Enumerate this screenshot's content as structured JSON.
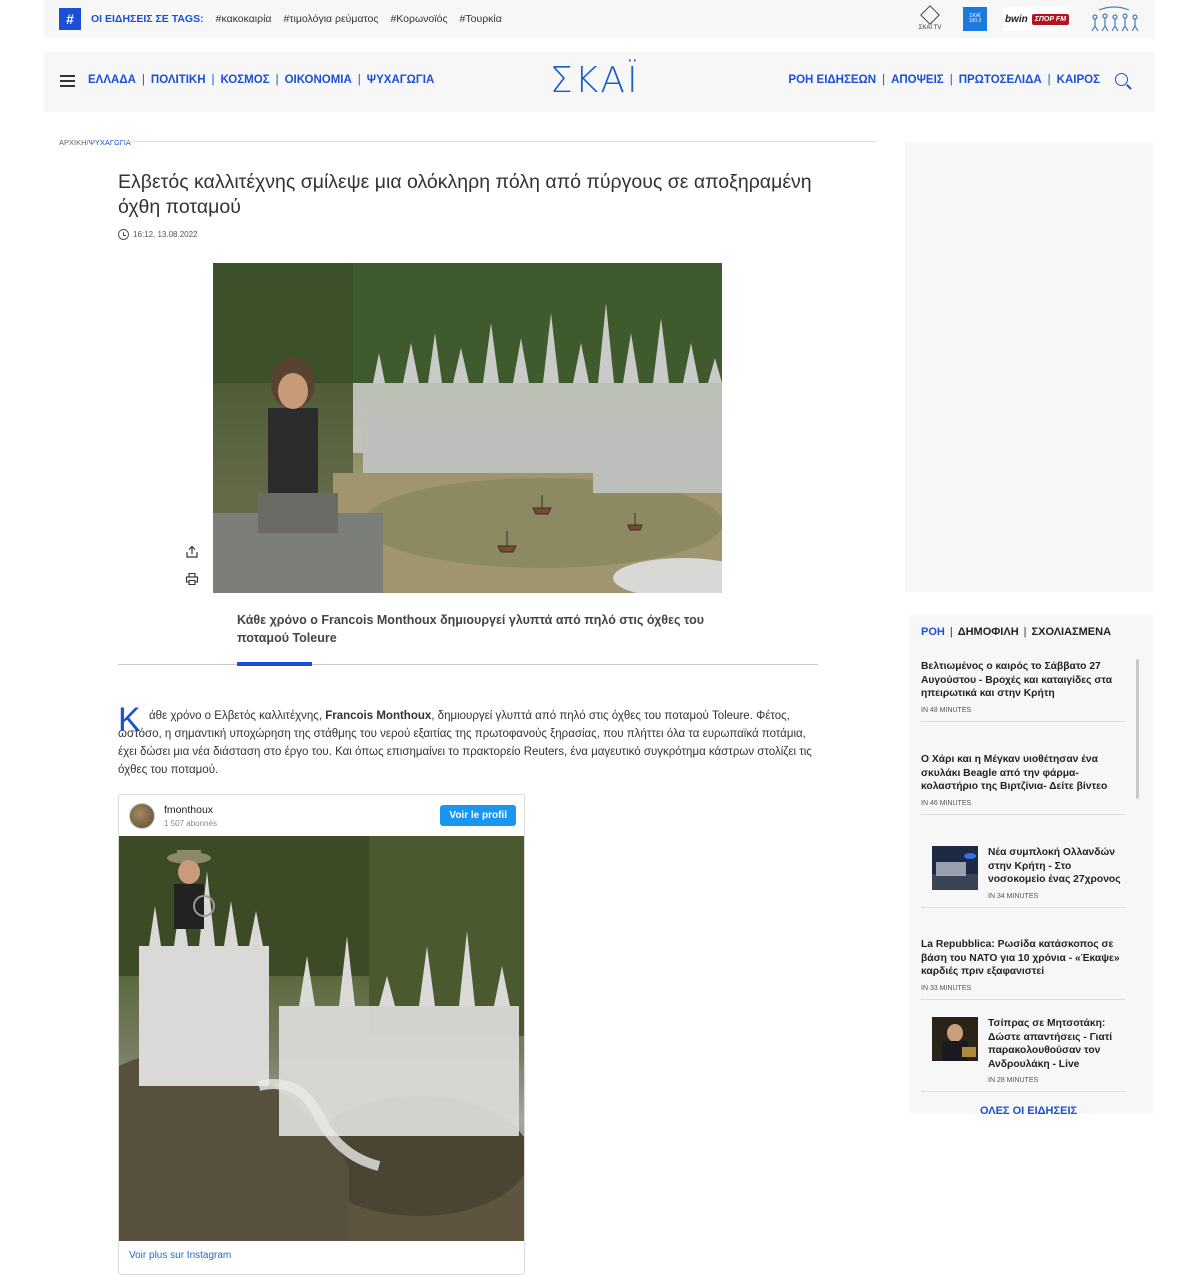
{
  "tagbar": {
    "hash": "#",
    "title": "ΟΙ ΕΙΔΗΣΕΙΣ ΣΕ TAGS:",
    "tags": [
      "#κακοκαιρία",
      "#τιμολόγια ρεύματος",
      "#Κορωνοϊός",
      "#Τουρκία"
    ],
    "icons": {
      "tv_label": "ΣΚΑΪ TV",
      "radio_label": "ΣΚΑΪ 100.3",
      "bwin_label": "bwin",
      "sport_label": "ΣΠΟΡ FM"
    }
  },
  "nav": {
    "left": [
      "ΕΛΛΑΔΑ",
      "ΠΟΛΙΤΙΚΗ",
      "ΚΟΣΜΟΣ",
      "ΟΙΚΟΝΟΜΙΑ",
      "ΨΥΧΑΓΩΓΙΑ"
    ],
    "right": [
      "ΡΟΗ ΕΙΔΗΣΕΩΝ",
      "ΑΠΟΨΕΙΣ",
      "ΠΡΩΤΟΣΕΛΙΔΑ",
      "ΚΑΙΡΟΣ"
    ],
    "logo": "ΣΚΑΪ",
    "sep": "|"
  },
  "breadcrumb": {
    "home": "ΑΡΧΙΚΗ",
    "sep": "/",
    "current": "ΨΥΧΑΓΩΓΙΑ"
  },
  "article": {
    "title": "Ελβετός καλλιτέχνης σμίλεψε μια ολόκληρη πόλη από πύργους σε αποξηραμένη όχθη ποταμού",
    "datetime": "16:12, 13.08.2022",
    "caption": "Κάθε χρόνο ο Francois Monthoux δημιουργεί γλυπτά από πηλό στις όχθες του ποταμού Toleure",
    "dropcap": "Κ",
    "body_before": "άθε χρόνο ο Ελβετός καλλιτέχνης, ",
    "body_bold": "Francois Monthoux",
    "body_after": ", δημιουργεί γλυπτά από πηλό στις όχθες του ποταμού Toleure. Φέτος, ωστόσο, η σημαντική υποχώρηση της στάθμης του νερού εξαιτίας της πρωτοφανούς ξηρασίας, που  πλήττει όλα τα ευρωπαϊκά ποτάμια, έχει δώσει μια νέα διάσταση στο έργο του. Και όπως επισημαίνει το πρακτορείο Reuters, ένα μαγευτικό  συγκρότημα κάστρων στολίζει τις όχθες του ποταμού."
  },
  "instagram": {
    "username": "fmonthoux",
    "followers": "1 507 abonnés",
    "button": "Voir le profil",
    "more": "Voir plus sur Instagram"
  },
  "sidebar": {
    "tabs": [
      "ΡΟΗ",
      "ΔΗΜΟΦΙΛΗ",
      "ΣΧΟΛΙΑΣΜΕΝΑ"
    ],
    "items": [
      {
        "title": "Βελτιωμένος ο καιρός το Σάββατο 27 Αυγούστου - Βροχές και καταιγίδες στα ηπειρωτικά και στην Κρήτη",
        "time": "IN 48 MINUTES"
      },
      {
        "title": "Ο Χάρι και η Μέγκαν υιοθέτησαν ένα σκυλάκι Beagle από την φάρμα-κολαστήριο της Βιρτζίνια- Δείτε βίντεο",
        "time": "IN 46 MINUTES"
      },
      {
        "title": "Νέα συμπλοκή Ολλανδών στην Κρήτη - Στο νοσοκομείο ένας 27χρονος",
        "time": "IN 34 MINUTES"
      },
      {
        "title": "La Repubblica: Ρωσίδα κατάσκοπος σε βάση του ΝΑΤΟ για 10 χρόνια - «Έκαψε» καρδιές πριν εξαφανιστεί",
        "time": "IN 33 MINUTES"
      },
      {
        "title": "Τσίπρας σε Μητσοτάκη: Δώστε απαντήσεις - Γιατί παρακολουθούσαν τον Ανδρουλάκη - Live",
        "time": "IN 28 MINUTES"
      }
    ],
    "all_news": "ΟΛΕΣ ΟΙ ΕΙΔΗΣΕΙΣ"
  },
  "colors": {
    "accent": "#1a4fd6",
    "panel": "#f7f7f7"
  }
}
